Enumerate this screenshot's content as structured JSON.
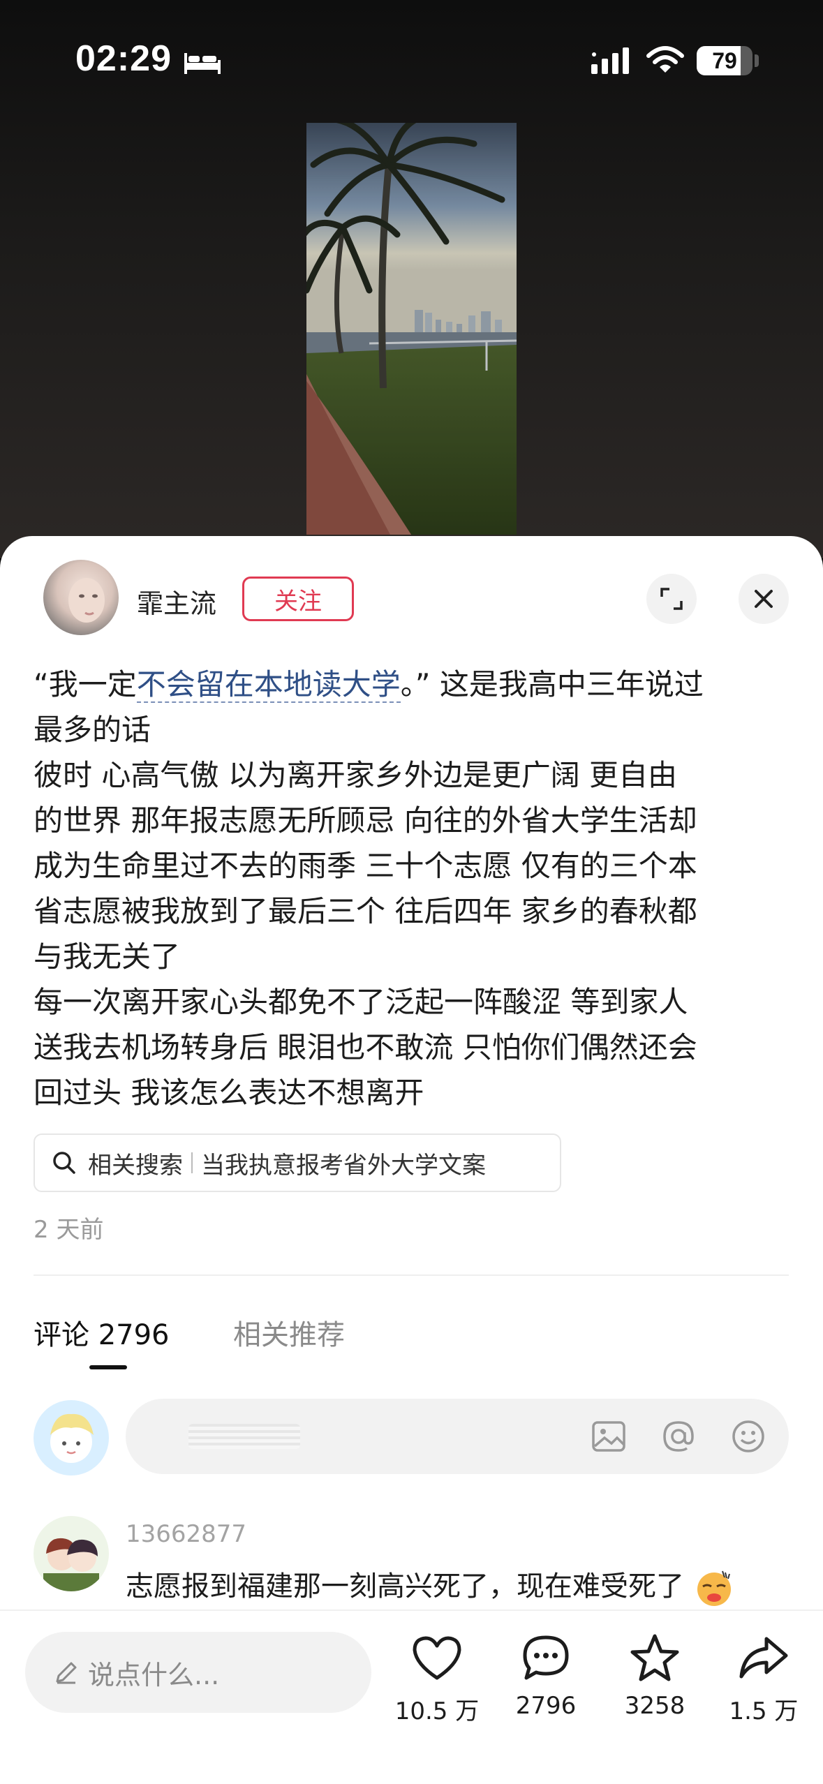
{
  "status_bar": {
    "time": "02:29",
    "battery_level": 79,
    "battery_text": "79",
    "icons": [
      "sleep-icon",
      "cellular-signal-icon",
      "wifi-icon",
      "battery-icon"
    ]
  },
  "post": {
    "author": {
      "name": "霏主流",
      "follow_label": "关注"
    },
    "body": {
      "line1_prefix": "“我一定",
      "line1_link": "不会留在本地读大学",
      "line1_suffix": "。” 这是我高中三年说过",
      "lines": [
        "最多的话",
        "彼时 心高气傲 以为离开家乡外边是更广阔 更自由",
        "的世界 那年报志愿无所顾忌 向往的外省大学生活却",
        "成为生命里过不去的雨季 三十个志愿 仅有的三个本",
        "省志愿被我放到了最后三个 往后四年 家乡的春秋都",
        "与我无关了",
        "每一次离开家心头都免不了泛起一阵酸涩 等到家人",
        "送我去机场转身后 眼泪也不敢流 只怕你们偶然还会",
        "回过头 我该怎么表达不想离开"
      ]
    },
    "related_search": {
      "label": "相关搜索",
      "query": "当我执意报考省外大学文案"
    },
    "time_ago": "2 天前"
  },
  "tabs": [
    {
      "label": "评论 2796",
      "active": true
    },
    {
      "label": "相关推荐",
      "active": false
    }
  ],
  "comment_input": {
    "icons": [
      "image-icon",
      "at-icon",
      "emoji-icon"
    ]
  },
  "comments": [
    {
      "user": "13662877",
      "text": "志愿报到福建那一刻高兴死了，现在难受死了"
    }
  ],
  "bottom_bar": {
    "placeholder": "说点什么...",
    "likes": "10.5 万",
    "comments": "2796",
    "favorites": "3258",
    "shares": "1.5 万"
  },
  "colors": {
    "accent_red": "#e03a52",
    "link_blue": "#2f4f86",
    "muted_gray": "#9a9a9a"
  }
}
